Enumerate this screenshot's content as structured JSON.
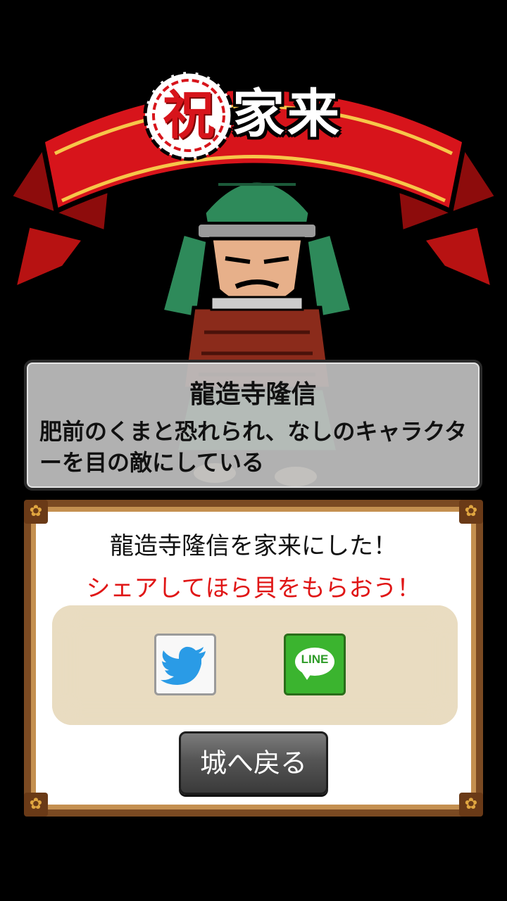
{
  "banner": {
    "celebrate_char": "祝",
    "title": "家来"
  },
  "character": {
    "name": "龍造寺隆信",
    "description": "肥前のくまと恐れられ、なしのキャラクターを目の敵にしている"
  },
  "dialog": {
    "message": "龍造寺隆信を家来にした！",
    "share_prompt": "シェアしてほら貝をもらおう！",
    "share_buttons": [
      {
        "name": "twitter",
        "icon": "twitter-bird-icon"
      },
      {
        "name": "line",
        "icon": "line-icon",
        "label": "LINE"
      }
    ],
    "back_label": "城へ戻る"
  },
  "colors": {
    "banner_red": "#d7141b",
    "prompt_red": "#e01616",
    "line_green": "#3bb42f",
    "twitter_blue": "#2a9be6"
  }
}
